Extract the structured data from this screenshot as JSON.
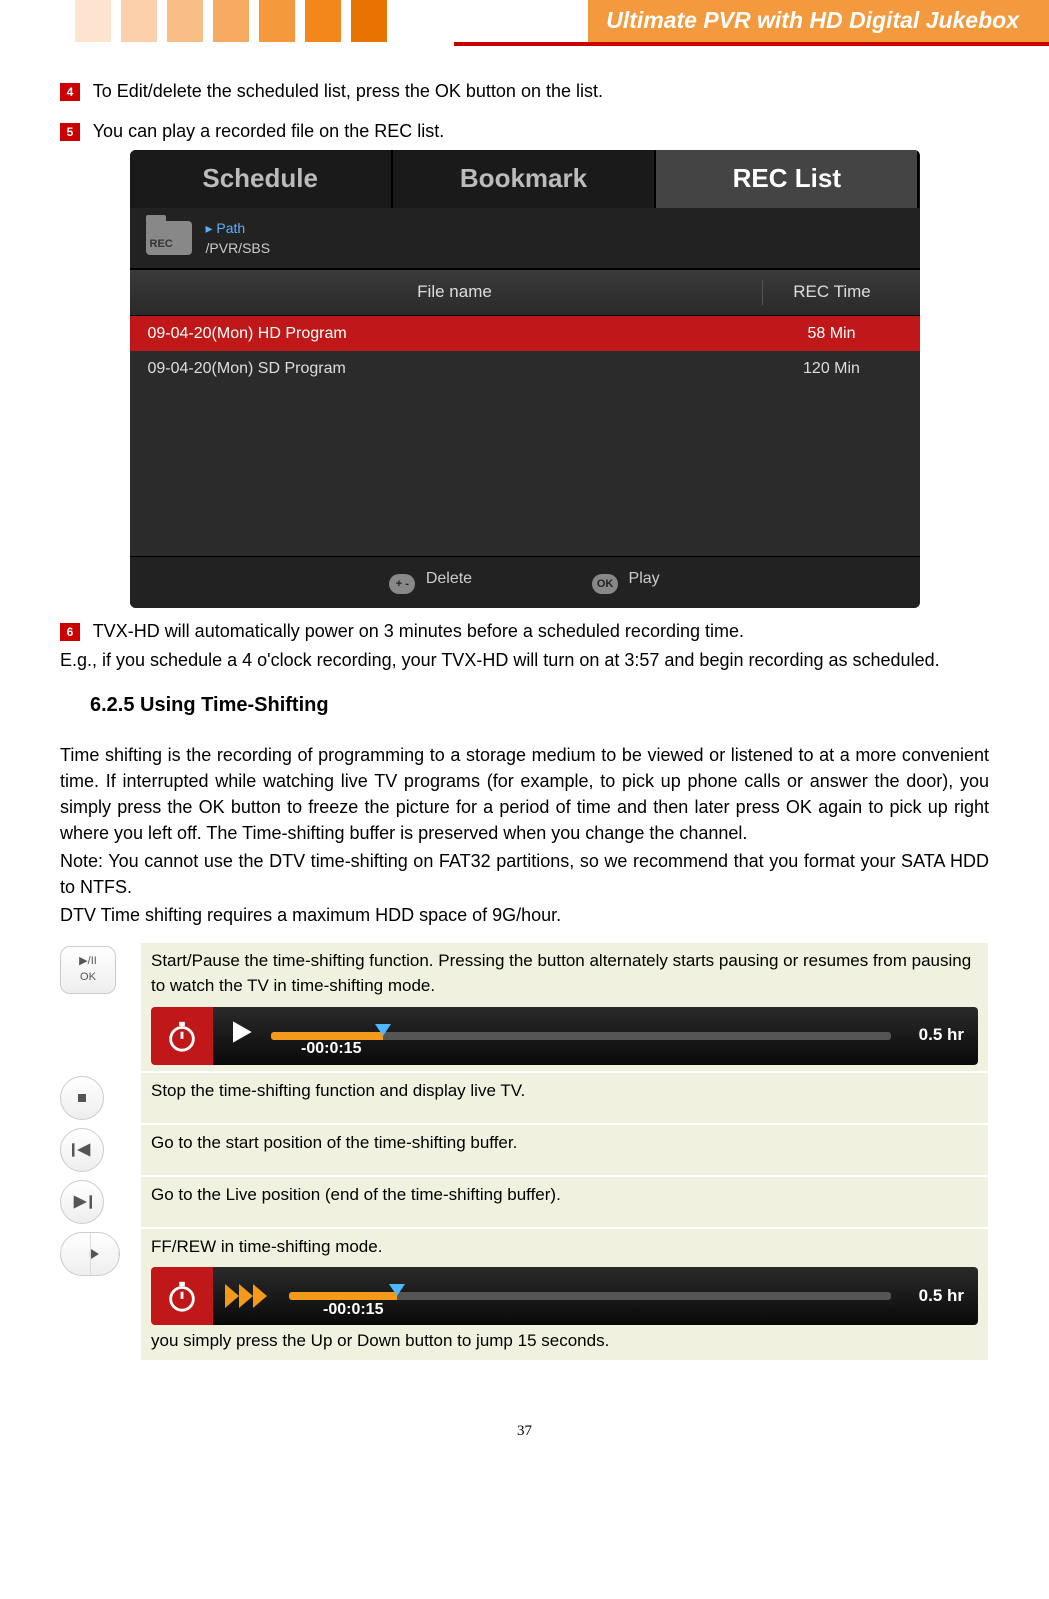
{
  "header": {
    "title": "Ultimate PVR with HD Digital Jukebox"
  },
  "steps": {
    "s4": {
      "num": "4",
      "text": "To Edit/delete the scheduled list, press the OK button on the list."
    },
    "s5": {
      "num": "5",
      "text": "You can play a recorded file on the REC list."
    },
    "s6": {
      "num": "6",
      "text": "TVX-HD will automatically power on 3 minutes before a scheduled recording time."
    }
  },
  "recshot": {
    "tabs": {
      "schedule": "Schedule",
      "bookmark": "Bookmark",
      "reclist": "REC List"
    },
    "folder_label": "REC",
    "path_prefix": "▸ Path",
    "path_value": "/PVR/SBS",
    "header": {
      "filename": "File name",
      "rectime": "REC Time"
    },
    "rows": [
      {
        "name": "09-04-20(Mon) HD Program",
        "time": "58 Min"
      },
      {
        "name": "09-04-20(Mon) SD Program",
        "time": "120 Min"
      }
    ],
    "footer": {
      "deleteBtn": "+ -",
      "deleteLabel": "Delete",
      "playBtn": "OK",
      "playLabel": "Play"
    }
  },
  "after6": "E.g., if you schedule a 4 o'clock recording, your TVX-HD will turn on at 3:57 and begin recording as scheduled.",
  "section": "6.2.5 Using Time-Shifting",
  "body": {
    "p1": "Time shifting is the recording of programming to a storage medium to be viewed or listened to at a more convenient time. If interrupted while watching live TV programs (for example, to pick up phone calls or answer the door), you simply press the OK button to freeze the picture for a period of time and then later press OK again to pick up right where you left off. The Time-shifting buffer is preserved when you change the channel.",
    "p2": "Note:   You cannot use the DTV time-shifting on FAT32 partitions, so we recommend that you format your SATA HDD to NTFS.",
    "p3": "DTV Time shifting requires a maximum HDD space of 9G/hour."
  },
  "controls": {
    "playpause": {
      "label_top": "▶/II",
      "label_bot": "OK",
      "desc": "Start/Pause the time-shifting function. Pressing the button alternately starts pausing or resumes from pausing to watch the TV in time-shifting mode."
    },
    "stop": {
      "desc": "Stop the time-shifting function and display live TV."
    },
    "prev": {
      "desc": "Go to the start position of the time-shifting buffer."
    },
    "next": {
      "desc": "Go to the Live position (end of the time-shifting buffer)."
    },
    "ffrew": {
      "desc": "FF/REW in time-shifting mode.",
      "tail": "you simply press the Up or Down button to jump 15 seconds."
    }
  },
  "timeline": {
    "time": "-00:0:15",
    "duration": "0.5 hr"
  },
  "pagenum": "37"
}
